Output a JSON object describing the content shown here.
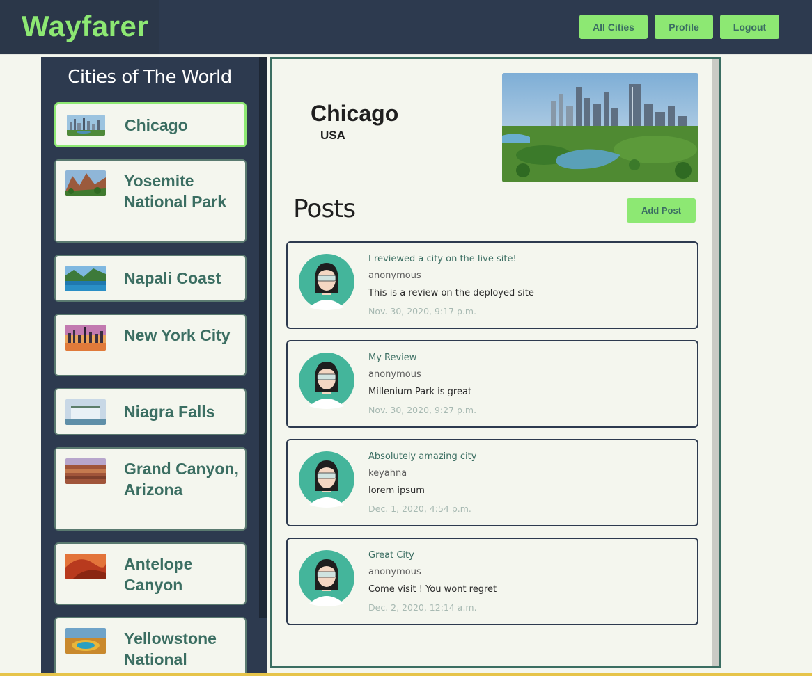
{
  "brand": "Wayfarer",
  "nav": {
    "all_cities": "All Cities",
    "profile": "Profile",
    "logout": "Logout"
  },
  "sidebar": {
    "title": "Cities of The World",
    "cities": [
      {
        "name": "Chicago",
        "active": true
      },
      {
        "name": "Yosemite National Park",
        "active": false
      },
      {
        "name": "Napali Coast",
        "active": false
      },
      {
        "name": "New York City",
        "active": false
      },
      {
        "name": "Niagra Falls",
        "active": false
      },
      {
        "name": "Grand Canyon, Arizona",
        "active": false
      },
      {
        "name": "Antelope Canyon",
        "active": false
      },
      {
        "name": "Yellowstone National",
        "active": false
      }
    ]
  },
  "city": {
    "name": "Chicago",
    "country": "USA"
  },
  "posts": {
    "heading": "Posts",
    "add_label": "Add Post",
    "items": [
      {
        "title": "I reviewed a city on the live site!",
        "author": "anonymous",
        "body": "This is a review on the deployed site",
        "date": "Nov. 30, 2020, 9:17 p.m."
      },
      {
        "title": "My Review",
        "author": "anonymous",
        "body": "Millenium Park is great",
        "date": "Nov. 30, 2020, 9:27 p.m."
      },
      {
        "title": "Absolutely amazing city",
        "author": "keyahna",
        "body": "lorem ipsum",
        "date": "Dec. 1, 2020, 4:54 p.m."
      },
      {
        "title": "Great City",
        "author": "anonymous",
        "body": "Come visit ! You wont regret",
        "date": "Dec. 2, 2020, 12:14 a.m."
      }
    ]
  },
  "colors": {
    "accent": "#8de873",
    "navy": "#2d3a4f",
    "teal": "#3b6e62"
  }
}
